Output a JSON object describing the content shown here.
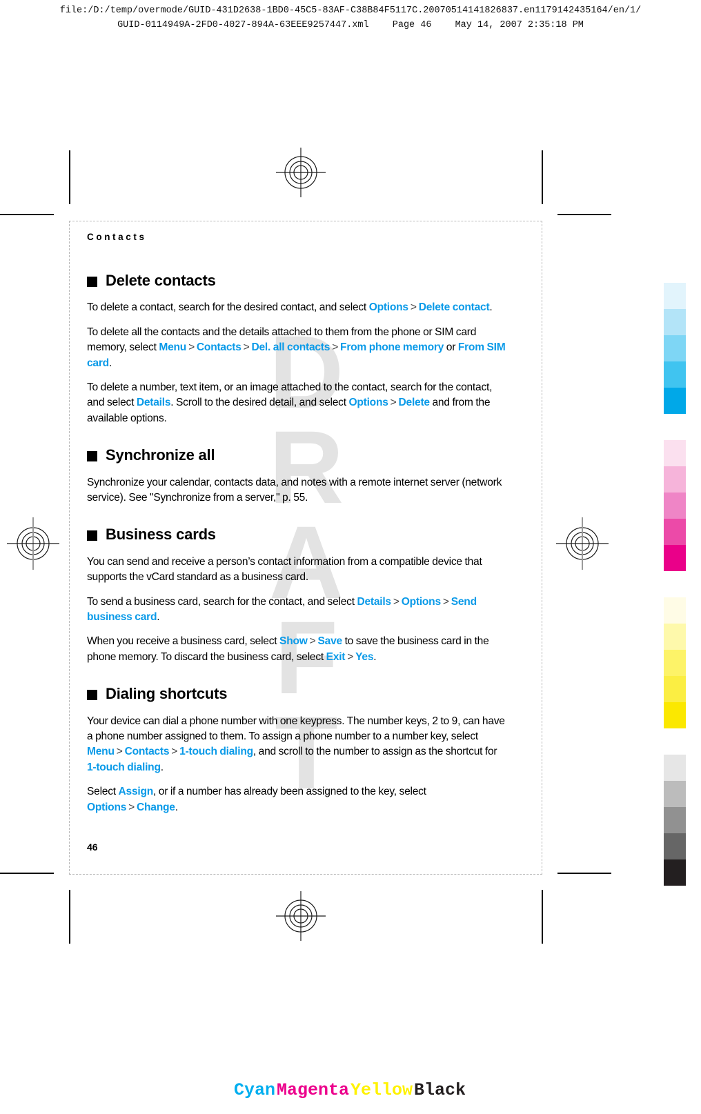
{
  "print_header": {
    "line1": "file:/D:/temp/overmode/GUID-431D2638-1BD0-45C5-83AF-C38B84F5117C.20070514141826837.en1179142435164/en/1/",
    "file": "GUID-0114949A-2FD0-4027-894A-63EEE9257447.xml",
    "page_label": "Page 46",
    "timestamp": "May 14, 2007 2:35:18 PM"
  },
  "watermark": "DRAFT",
  "page": {
    "running_head": "Contacts",
    "folio": "46",
    "sections": [
      {
        "id": "delete-contacts",
        "heading": "Delete contacts",
        "paragraphs": [
          {
            "id": "p-delete-one",
            "runs": [
              {
                "t": "To delete a contact, search for the desired contact, and select ",
                "s": "plain"
              },
              {
                "t": "Options",
                "s": "ui"
              },
              {
                "t": ">",
                "s": "chev"
              },
              {
                "t": "Delete contact",
                "s": "ui"
              },
              {
                "t": ".",
                "s": "plain"
              }
            ]
          },
          {
            "id": "p-delete-all",
            "runs": [
              {
                "t": "To delete all the contacts and the details attached to them from the phone or SIM card memory, select ",
                "s": "plain"
              },
              {
                "t": "Menu",
                "s": "ui"
              },
              {
                "t": ">",
                "s": "chev"
              },
              {
                "t": "Contacts",
                "s": "ui"
              },
              {
                "t": ">",
                "s": "chev"
              },
              {
                "t": "Del. all contacts",
                "s": "ui"
              },
              {
                "t": ">",
                "s": "chev"
              },
              {
                "t": "From phone memory",
                "s": "ui"
              },
              {
                "t": " or ",
                "s": "plain"
              },
              {
                "t": "From SIM card",
                "s": "ui"
              },
              {
                "t": ".",
                "s": "plain"
              }
            ]
          },
          {
            "id": "p-delete-detail",
            "runs": [
              {
                "t": "To delete a number, text item, or an image attached to the contact, search for the contact, and select ",
                "s": "plain"
              },
              {
                "t": "Details",
                "s": "ui"
              },
              {
                "t": ". Scroll to the desired detail, and select ",
                "s": "plain"
              },
              {
                "t": "Options",
                "s": "ui"
              },
              {
                "t": ">",
                "s": "chev"
              },
              {
                "t": "Delete",
                "s": "ui"
              },
              {
                "t": " and from the available options.",
                "s": "plain"
              }
            ]
          }
        ]
      },
      {
        "id": "synchronize-all",
        "heading": "Synchronize all",
        "paragraphs": [
          {
            "id": "p-sync",
            "runs": [
              {
                "t": "Synchronize your calendar, contacts data, and notes with a remote internet server (network service). See \"Synchronize from a server,\" p. 55.",
                "s": "plain"
              }
            ]
          }
        ]
      },
      {
        "id": "business-cards",
        "heading": "Business cards",
        "paragraphs": [
          {
            "id": "p-vcard",
            "runs": [
              {
                "t": "You can send and receive a person’s contact information from a compatible device that supports the vCard standard as a business card.",
                "s": "plain"
              }
            ]
          },
          {
            "id": "p-send-card",
            "runs": [
              {
                "t": "To send a business card, search for the contact, and select ",
                "s": "plain"
              },
              {
                "t": "Details",
                "s": "ui"
              },
              {
                "t": ">",
                "s": "chev"
              },
              {
                "t": "Options",
                "s": "ui"
              },
              {
                "t": ">",
                "s": "chev"
              },
              {
                "t": "Send business card",
                "s": "ui"
              },
              {
                "t": ".",
                "s": "plain"
              }
            ]
          },
          {
            "id": "p-receive-card",
            "runs": [
              {
                "t": "When you receive a business card, select ",
                "s": "plain"
              },
              {
                "t": "Show",
                "s": "ui"
              },
              {
                "t": ">",
                "s": "chev"
              },
              {
                "t": "Save",
                "s": "ui"
              },
              {
                "t": " to save the business card in the phone memory. To discard the business card, select ",
                "s": "plain"
              },
              {
                "t": "Exit",
                "s": "ui"
              },
              {
                "t": ">",
                "s": "chev"
              },
              {
                "t": "Yes",
                "s": "ui"
              },
              {
                "t": ".",
                "s": "plain"
              }
            ]
          }
        ]
      },
      {
        "id": "dialing-shortcuts",
        "heading": "Dialing shortcuts",
        "paragraphs": [
          {
            "id": "p-one-touch",
            "runs": [
              {
                "t": "Your device can dial a phone number with one keypress. The number keys, 2 to 9, can have a phone number assigned to them. To assign a phone number to a number key, select ",
                "s": "plain"
              },
              {
                "t": "Menu",
                "s": "ui"
              },
              {
                "t": ">",
                "s": "chev"
              },
              {
                "t": "Contacts",
                "s": "ui"
              },
              {
                "t": ">",
                "s": "chev"
              },
              {
                "t": "1-touch dialing",
                "s": "ui"
              },
              {
                "t": ", and scroll to the number to assign as the shortcut for ",
                "s": "plain"
              },
              {
                "t": "1-touch dialing",
                "s": "ui"
              },
              {
                "t": ".",
                "s": "plain"
              }
            ]
          },
          {
            "id": "p-assign",
            "runs": [
              {
                "t": "Select ",
                "s": "plain"
              },
              {
                "t": "Assign",
                "s": "ui"
              },
              {
                "t": ", or if a number has already been assigned to the key, select ",
                "s": "plain"
              },
              {
                "t": "Options",
                "s": "ui"
              },
              {
                "t": ">",
                "s": "chev"
              },
              {
                "t": "Change",
                "s": "ui"
              },
              {
                "t": ".",
                "s": "plain"
              }
            ]
          }
        ]
      }
    ]
  },
  "color_bar": {
    "names": [
      {
        "label": "Cyan",
        "color": "#00aeef"
      },
      {
        "label": "Magenta",
        "color": "#ec008c"
      },
      {
        "label": "Yellow",
        "color": "#fff200"
      },
      {
        "label": "Black",
        "color": "#231f20"
      }
    ]
  },
  "color_strips": [
    {
      "name": "cyan",
      "swatches": [
        "#e2f4fc",
        "#b3e4f8",
        "#7ed6f5",
        "#40c4f0",
        "#00a8e8"
      ]
    },
    {
      "name": "magenta",
      "swatches": [
        "#fbe0ef",
        "#f6b4da",
        "#ef85c6",
        "#ec4aa8",
        "#ea0089"
      ]
    },
    {
      "name": "yellow",
      "swatches": [
        "#fffce6",
        "#fef9ab",
        "#fdf368",
        "#fbee43",
        "#fbe800"
      ]
    },
    {
      "name": "black",
      "swatches": [
        "#e6e6e6",
        "#bcbcbc",
        "#919191",
        "#666666",
        "#231f20"
      ]
    }
  ],
  "ui_accent": "#0a9ae8"
}
